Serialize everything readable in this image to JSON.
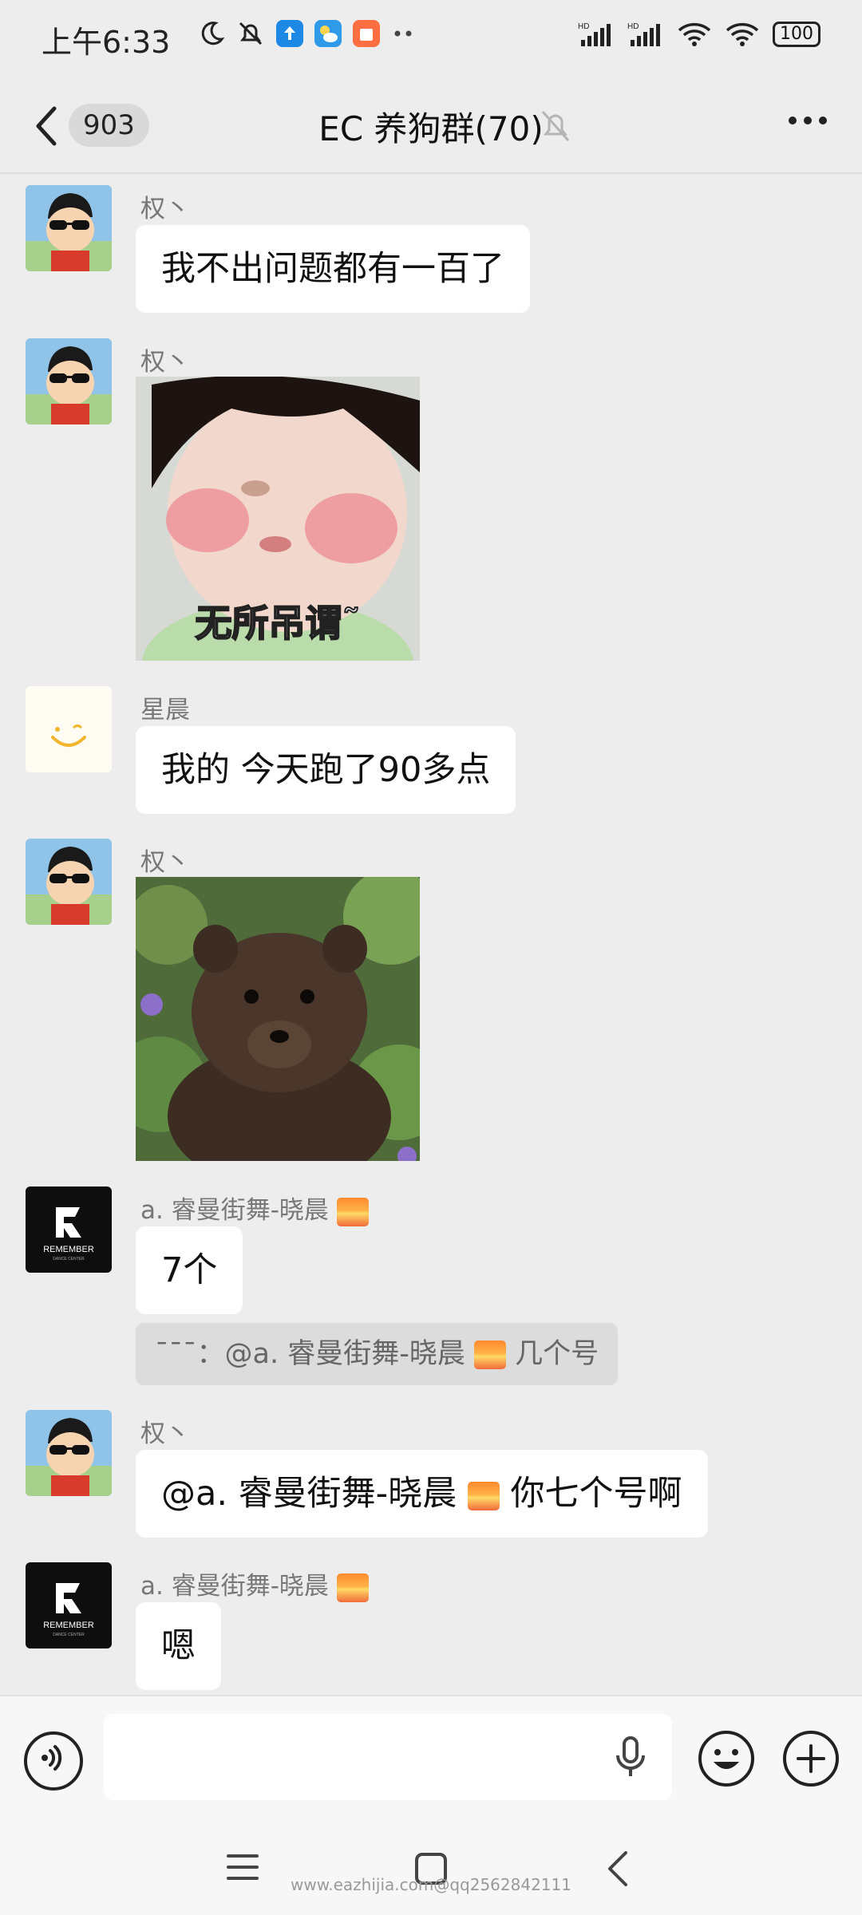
{
  "status": {
    "time": "上午6:33",
    "battery": "100"
  },
  "header": {
    "unread_count": "903",
    "title": "EC 养狗群(70)"
  },
  "messages": [
    {
      "sender": "权丶",
      "text": "我不出问题都有一百了"
    },
    {
      "sender": "权丶",
      "type": "sticker",
      "caption": "无所吊谓˜"
    },
    {
      "sender": "星晨",
      "text": "我的 今天跑了90多点"
    },
    {
      "sender": "权丶",
      "type": "sticker"
    },
    {
      "sender": "a. 睿曼街舞-晓晨",
      "text": "7个",
      "quote_prefix": "ˉˉˉ：@a. 睿曼街舞-晓晨",
      "quote_suffix": "几个号"
    },
    {
      "sender": "权丶",
      "text_prefix": "@a. 睿曼街舞-晓晨",
      "text_suffix": "你七个号啊"
    },
    {
      "sender": "a. 睿曼街舞-晓晨",
      "text": "嗯"
    }
  ],
  "avatars": {
    "remember_text": "REMEMBER",
    "remember_sub": "DANCE CENTER"
  },
  "input": {
    "placeholder": ""
  },
  "watermark": "www.eazhijia.com@qq2562842111",
  "colors": {
    "background": "#ededed",
    "bubble": "#ffffff",
    "quote": "#dcdcdc"
  }
}
